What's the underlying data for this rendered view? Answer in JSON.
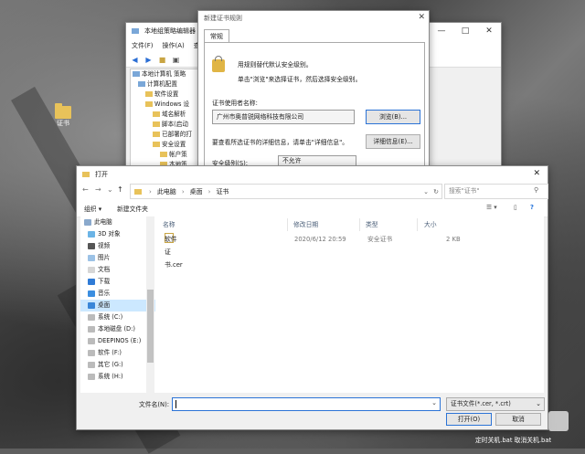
{
  "desktop": {
    "icon_label": "证书",
    "taskbar_text": "定时关机.bat  取消关机.bat"
  },
  "gpe": {
    "title": "本地组策略编辑器",
    "menu": [
      "文件(F)",
      "操作(A)",
      "查看"
    ],
    "tree": [
      "本地计算机 策略",
      "计算机配置",
      "软件设置",
      "Windows 设",
      "域名解析",
      "脚本(启动",
      "已部署的打",
      "安全设置",
      "帐户策",
      "本地策"
    ]
  },
  "cert_rule": {
    "title": "新建证书规则",
    "tab": "常规",
    "desc1": "用规则替代默认安全级别。",
    "desc2": "单击\"浏览\"来选择证书，然后选择安全级别。",
    "subject_label": "证书使用者名称:",
    "subject_value": "广州市奥普锐网络科技有限公司",
    "browse_btn": "浏览(B)...",
    "details_text": "要查看所选证书的详细信息，请单击\"详细信息\"。",
    "details_btn": "详细信息(E)...",
    "security_label": "安全级别(S):",
    "security_value": "不允许"
  },
  "open_dialog": {
    "title": "打开",
    "breadcrumb": [
      "此电脑",
      "桌面",
      "证书"
    ],
    "search_placeholder": "搜索\"证书\"",
    "organize": "组织 ▾",
    "new_folder": "新建文件夹",
    "nav_items": [
      {
        "label": "此电脑",
        "icon": "pc-icon"
      },
      {
        "label": "3D 对象",
        "icon": "3d-objects-icon"
      },
      {
        "label": "视频",
        "icon": "video-icon"
      },
      {
        "label": "图片",
        "icon": "pictures-icon"
      },
      {
        "label": "文档",
        "icon": "documents-icon"
      },
      {
        "label": "下载",
        "icon": "download-icon"
      },
      {
        "label": "音乐",
        "icon": "music-icon"
      },
      {
        "label": "桌面",
        "icon": "desktop-icon"
      },
      {
        "label": "系统 (C:)",
        "icon": "drive-icon"
      },
      {
        "label": "本地磁盘 (D:)",
        "icon": "drive-icon"
      },
      {
        "label": "DEEPINOS (E:)",
        "icon": "drive-icon"
      },
      {
        "label": "软件 (F:)",
        "icon": "drive-icon"
      },
      {
        "label": "其它 (G:)",
        "icon": "drive-icon"
      },
      {
        "label": "系统 (H:)",
        "icon": "drive-icon"
      }
    ],
    "columns": {
      "name": "名称",
      "date": "修改日期",
      "type": "类型",
      "size": "大小"
    },
    "files": [
      {
        "name": "软件证书.cer",
        "date": "2020/6/12 20:59",
        "type": "安全证书",
        "size": "2 KB"
      }
    ],
    "filename_label": "文件名(N):",
    "filename_value": "",
    "filetype": "证书文件(*.cer, *.crt)",
    "open_btn": "打开(O)",
    "cancel_btn": "取消"
  }
}
